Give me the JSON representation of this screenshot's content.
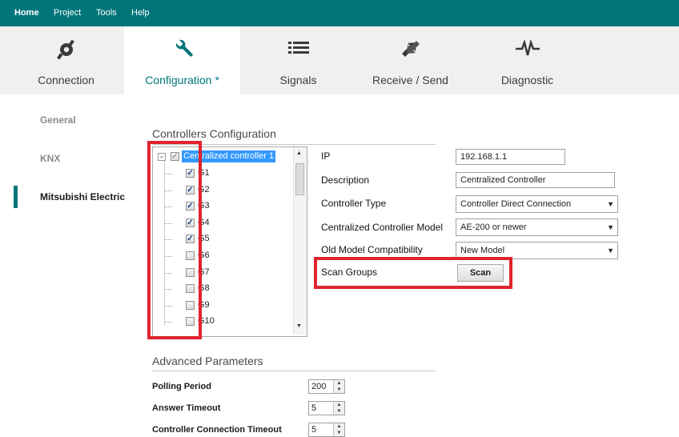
{
  "menu": [
    "Home",
    "Project",
    "Tools",
    "Help"
  ],
  "tabs": [
    {
      "label": "Connection",
      "icon": "connection-plug-icon"
    },
    {
      "label": "Configuration *",
      "icon": "wrench-icon"
    },
    {
      "label": "Signals",
      "icon": "list-icon"
    },
    {
      "label": "Receive / Send",
      "icon": "transfer-arrows-icon"
    },
    {
      "label": "Diagnostic",
      "icon": "pulse-icon"
    }
  ],
  "sidebar": [
    "General",
    "KNX",
    "Mitsubishi Electric"
  ],
  "controllers": {
    "title": "Controllers Configuration",
    "root": "Centralized controller 1",
    "groups": [
      {
        "name": "G1",
        "checked": true
      },
      {
        "name": "G2",
        "checked": true
      },
      {
        "name": "G3",
        "checked": true
      },
      {
        "name": "G4",
        "checked": true
      },
      {
        "name": "G5",
        "checked": true
      },
      {
        "name": "G6",
        "checked": false
      },
      {
        "name": "G7",
        "checked": false
      },
      {
        "name": "G8",
        "checked": false
      },
      {
        "name": "G9",
        "checked": false
      },
      {
        "name": "G10",
        "checked": false
      }
    ]
  },
  "fields": {
    "ip_label": "IP",
    "ip_value": "192.168.1.1",
    "description_label": "Description",
    "description_value": "Centralized Controller",
    "controller_type_label": "Controller Type",
    "controller_type_value": "Controller Direct Connection",
    "model_label": "Centralized Controller Model",
    "model_value": "AE-200 or newer",
    "compat_label": "Old Model Compatibility",
    "compat_value": "New Model",
    "scan_groups_label": "Scan Groups",
    "scan_button": "Scan"
  },
  "advanced": {
    "title": "Advanced Parameters",
    "polling_label": "Polling Period",
    "polling_value": "200",
    "answer_label": "Answer Timeout",
    "answer_value": "5",
    "conn_label": "Controller Connection Timeout",
    "conn_value": "5"
  },
  "colors": {
    "accent": "#00767a",
    "highlight": "#e0242e",
    "selection": "#3399ff"
  }
}
